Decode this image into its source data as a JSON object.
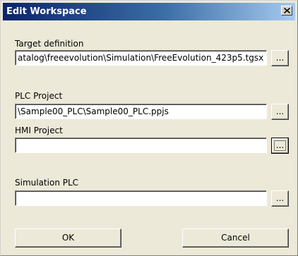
{
  "window": {
    "title": "Edit Workspace",
    "close_label": "×"
  },
  "target_definition": {
    "label": "Target definition",
    "value": "atalog\\freeevolution\\Simulation\\FreeEvolution_423p5.tgsx",
    "browse_label": "..."
  },
  "plc_project": {
    "label": "PLC Project",
    "value": "\\Sample00_PLC\\Sample00_PLC.ppjs",
    "browse_label": "..."
  },
  "hmi_project": {
    "label": "HMI Project",
    "value": "",
    "browse_label": "..."
  },
  "simulation_plc": {
    "label": "Simulation PLC",
    "value": "",
    "browse_label": "..."
  },
  "buttons": {
    "ok": "OK",
    "cancel": "Cancel"
  },
  "colors": {
    "titlebar_start": "#0a246a",
    "titlebar_end": "#a6caf0",
    "dialog_bg": "#ece9d8"
  }
}
